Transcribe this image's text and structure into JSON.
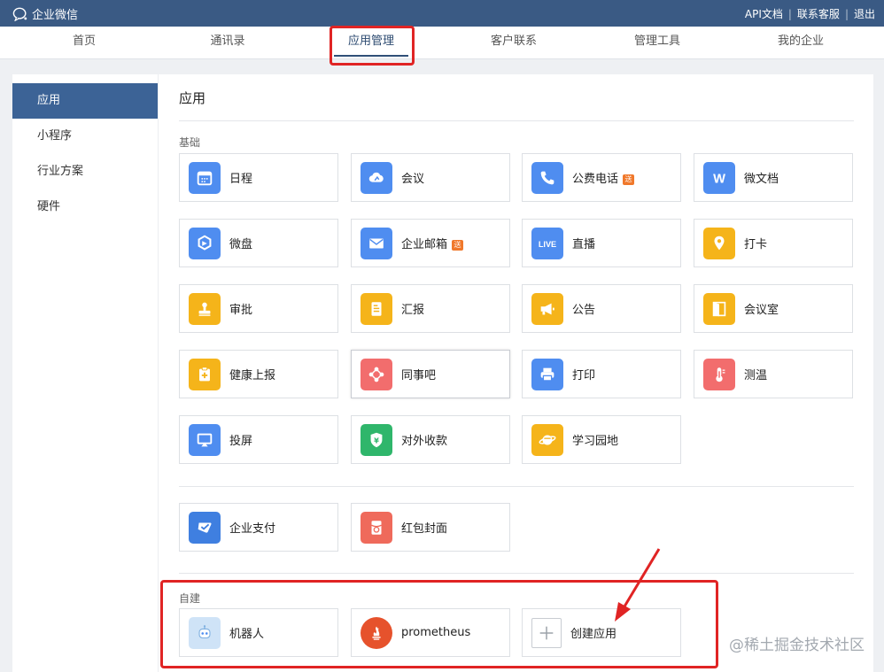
{
  "topbar": {
    "brand": "企业微信",
    "links": [
      "API文档",
      "联系客服",
      "退出"
    ]
  },
  "nav": {
    "items": [
      "首页",
      "通讯录",
      "应用管理",
      "客户联系",
      "管理工具",
      "我的企业"
    ],
    "active_index": 2
  },
  "sidebar": {
    "items": [
      "应用",
      "小程序",
      "行业方案",
      "硬件"
    ],
    "active_index": 0
  },
  "content": {
    "title": "应用",
    "basic_label": "基础",
    "basic_apps": [
      {
        "label": "日程",
        "icon": "calendar-icon",
        "color": "#4f8df0"
      },
      {
        "label": "会议",
        "icon": "cloud-icon",
        "color": "#4f8df0"
      },
      {
        "label": "公费电话",
        "icon": "phone-icon",
        "color": "#4f8df0",
        "badge": "送"
      },
      {
        "label": "微文档",
        "icon": "document-w-icon",
        "color": "#4f8df0"
      },
      {
        "label": "微盘",
        "icon": "disk-icon",
        "color": "#4f8df0"
      },
      {
        "label": "企业邮箱",
        "icon": "mail-icon",
        "color": "#4f8df0",
        "badge": "送"
      },
      {
        "label": "直播",
        "icon": "live-icon",
        "color": "#4f8df0"
      },
      {
        "label": "打卡",
        "icon": "location-pin-icon",
        "color": "#f5b41a"
      },
      {
        "label": "审批",
        "icon": "stamp-icon",
        "color": "#f5b41a"
      },
      {
        "label": "汇报",
        "icon": "report-icon",
        "color": "#f5b41a"
      },
      {
        "label": "公告",
        "icon": "megaphone-icon",
        "color": "#f5b41a"
      },
      {
        "label": "会议室",
        "icon": "door-icon",
        "color": "#f5b41a"
      },
      {
        "label": "健康上报",
        "icon": "health-report-icon",
        "color": "#f5b41a"
      },
      {
        "label": "同事吧",
        "icon": "share-nodes-icon",
        "color": "#f26d6d"
      },
      {
        "label": "打印",
        "icon": "printer-icon",
        "color": "#4f8df0"
      },
      {
        "label": "测温",
        "icon": "thermometer-icon",
        "color": "#f26d6d"
      },
      {
        "label": "投屏",
        "icon": "screen-cast-icon",
        "color": "#4f8df0"
      },
      {
        "label": "对外收款",
        "icon": "yuan-shield-icon",
        "color": "#2fb66b"
      },
      {
        "label": "学习园地",
        "icon": "planet-icon",
        "color": "#f5b41a"
      }
    ],
    "extra_apps": [
      {
        "label": "企业支付",
        "icon": "pay-icon",
        "color": "#3f7fe0"
      },
      {
        "label": "红包封面",
        "icon": "red-envelope-icon",
        "color": "#ef6a5b"
      }
    ],
    "custom_label": "自建",
    "custom_apps": [
      {
        "label": "机器人",
        "icon": "robot-icon",
        "color": "#cfe3f7"
      },
      {
        "label": "prometheus",
        "icon": "prometheus-icon",
        "color": "#e6522c"
      },
      {
        "label": "创建应用",
        "icon": "plus-icon",
        "color": "#ffffff"
      }
    ]
  },
  "watermark": "@稀土掘金技术社区",
  "annotation_color": "#e02424"
}
